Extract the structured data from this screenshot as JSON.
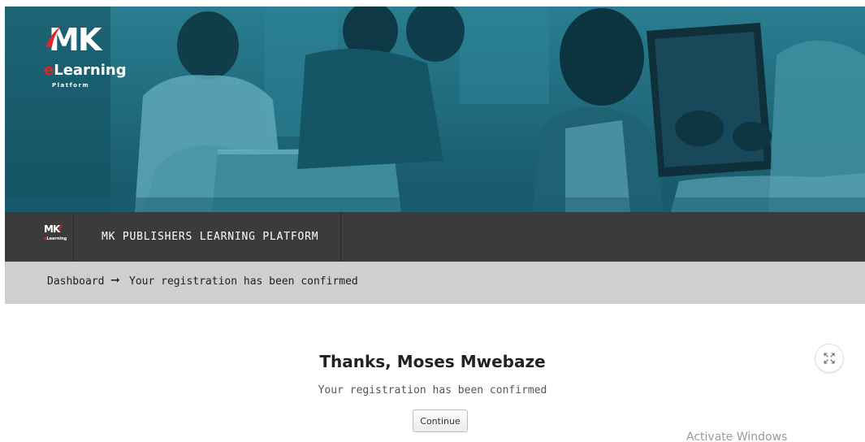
{
  "hero": {
    "logo": {
      "mk": "MK",
      "learning_prefix": "e",
      "learning": "Learning",
      "platform": "Platform",
      "icon": "mk-elearning-logo"
    }
  },
  "navbar": {
    "logo": {
      "mk": "MK",
      "learning_prefix": "e",
      "learning": "Learning"
    },
    "title": "MK PUBLISHERS LEARNING PLATFORM"
  },
  "breadcrumb": {
    "home": "Dashboard",
    "separator_icon": "arrow-right-icon",
    "current": "Your registration has been confirmed"
  },
  "content": {
    "heading": "Thanks, Moses Mwebaze",
    "message": "Your registration has been confirmed",
    "continue_label": "Continue"
  },
  "fullscreen_toggle": {
    "icon": "expand-arrows-icon"
  },
  "watermark": {
    "text": "Activate Windows"
  },
  "colors": {
    "hero_teal": "#1c6a7c",
    "navbar": "#3b3b3b",
    "breadcrumb_bg": "#cfcfcf",
    "logo_accent": "#e02424"
  }
}
